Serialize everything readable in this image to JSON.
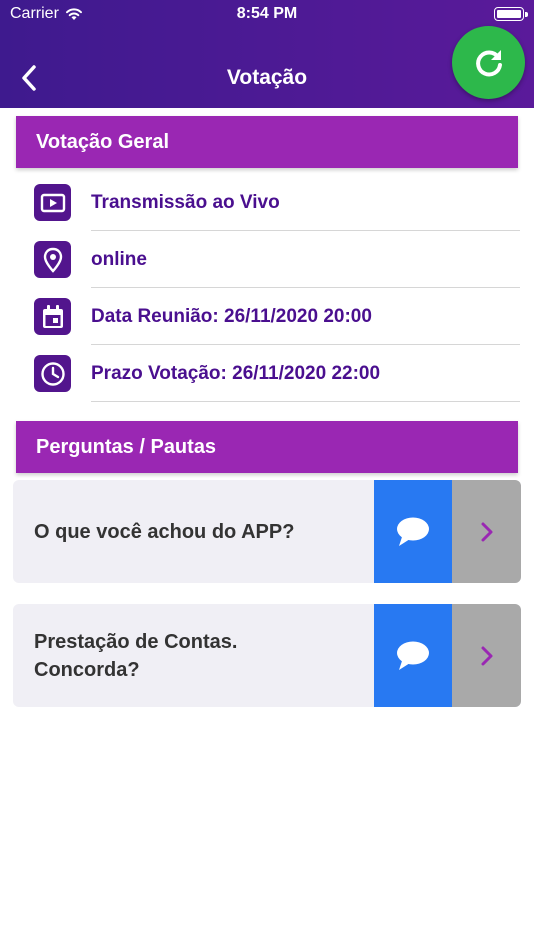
{
  "status_bar": {
    "carrier": "Carrier",
    "time": "8:54 PM"
  },
  "header": {
    "title": "Votação",
    "back_icon": "chevron-left-icon",
    "refresh_icon": "refresh-icon"
  },
  "colors": {
    "header": "#4a178f",
    "section": "#9a27b3",
    "refresh": "#2db84b",
    "icon_bg": "#52158d",
    "text_accent": "#4a0f8f",
    "comment": "#2879f2",
    "open": "#a9a9a9"
  },
  "general": {
    "title": "Votação Geral",
    "items": [
      {
        "icon": "video-icon",
        "text": "Transmissão ao Vivo"
      },
      {
        "icon": "location-pin-icon",
        "text": "online"
      },
      {
        "icon": "calendar-icon",
        "text": "Data Reunião: 26/11/2020 20:00"
      },
      {
        "icon": "clock-icon",
        "text": "Prazo Votação: 26/11/2020 22:00"
      }
    ]
  },
  "questions": {
    "title": "Perguntas / Pautas",
    "items": [
      {
        "text": "O que você achou do APP?"
      },
      {
        "text": "Prestação de Contas.\nConcorda?"
      }
    ]
  }
}
